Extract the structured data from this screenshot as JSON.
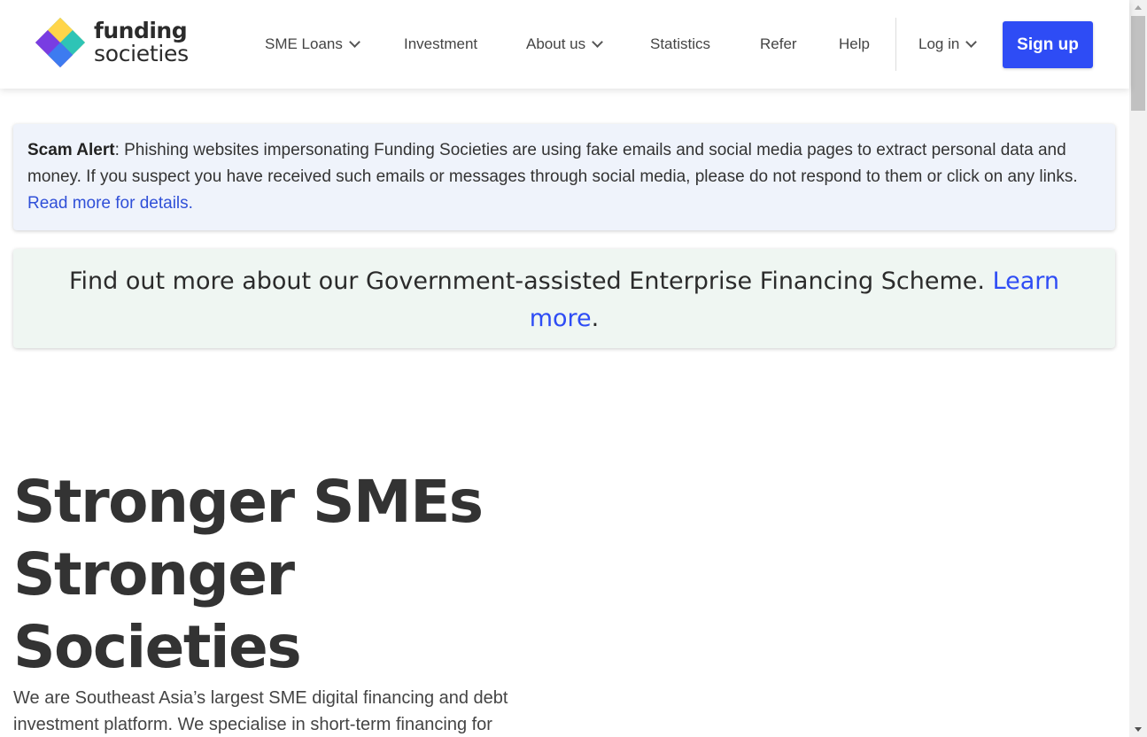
{
  "brand": {
    "line1": "funding",
    "line2": "societies"
  },
  "nav": {
    "items": [
      {
        "label": "SME Loans",
        "dropdown": true
      },
      {
        "label": "Investment",
        "dropdown": false
      },
      {
        "label": "About us",
        "dropdown": true
      },
      {
        "label": "Statistics",
        "dropdown": false
      },
      {
        "label": "Refer",
        "dropdown": false
      },
      {
        "label": "Help",
        "dropdown": false
      }
    ],
    "login_label": "Log in",
    "signup_label": "Sign up"
  },
  "scam_alert": {
    "title": "Scam Alert",
    "body": ": Phishing websites impersonating Funding Societies are using fake emails and social media pages to extract personal data and money. If you suspect you have received such emails or messages through social media, please do not respond to them or click on any links. ",
    "link": "Read more for details."
  },
  "gov_banner": {
    "text": "Find out more about our Government-assisted Enterprise Financing Scheme. ",
    "link": "Learn more",
    "suffix": "."
  },
  "hero": {
    "title_lines": [
      "Stronger SMEs",
      "Stronger",
      "Societies"
    ],
    "description": "We are Southeast Asia’s largest SME digital financing and debt investment platform. We specialise in short-term financing for"
  },
  "colors": {
    "primary": "#2e4cf5",
    "scam_bg": "#eff3fb",
    "gov_bg": "#eff6f2",
    "text": "#333333"
  }
}
